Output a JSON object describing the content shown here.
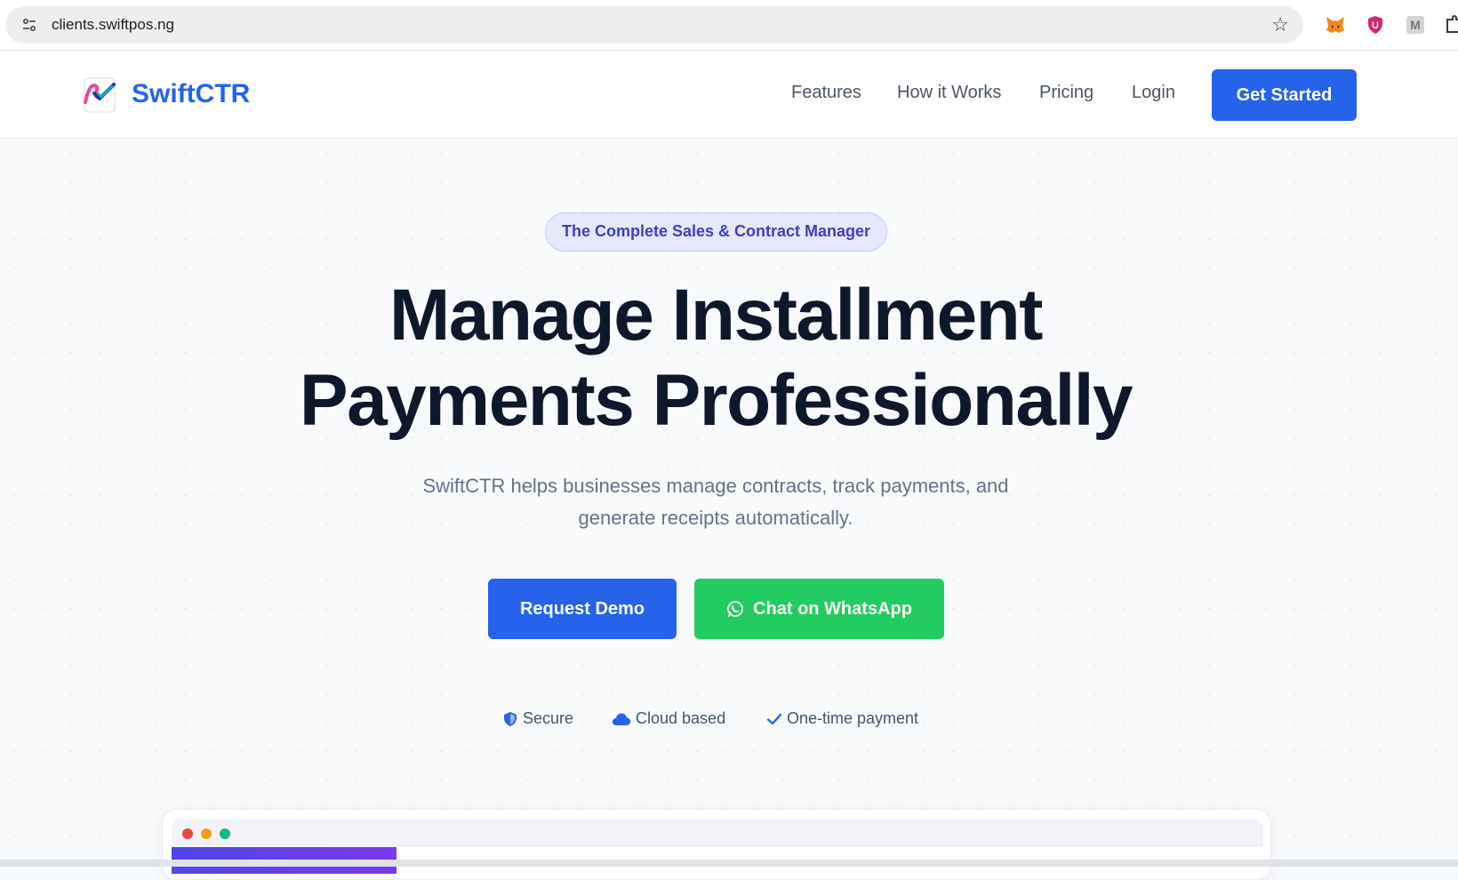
{
  "browser": {
    "url": "clients.swiftpos.ng",
    "icons": [
      "site-settings-icon",
      "bookmark-star-icon",
      "metamask-extension-icon",
      "ublock-extension-icon",
      "m-extension-icon",
      "extensions-puzzle-icon"
    ]
  },
  "header": {
    "brand_name": "SwiftCTR",
    "nav": [
      "Features",
      "How it Works",
      "Pricing",
      "Login"
    ],
    "cta_label": "Get Started"
  },
  "hero": {
    "pill_label": "The Complete Sales & Contract Manager",
    "headline_line1": "Manage Installment",
    "headline_line2": "Payments Professionally",
    "subtext_line1": "SwiftCTR helps businesses manage contracts, track payments, and",
    "subtext_line2": "generate receipts automatically.",
    "demo_label": "Request Demo",
    "whatsapp_label": "Chat on WhatsApp",
    "features": [
      {
        "label": "Secure",
        "icon": "shield-icon"
      },
      {
        "label": "Cloud based",
        "icon": "cloud-icon"
      },
      {
        "label": "One-time payment",
        "icon": "check-icon"
      }
    ]
  },
  "colors": {
    "primary": "#2563eb",
    "whatsapp": "#22cc5e",
    "headline": "#0f172a",
    "pill_bg": "#e6e8fd",
    "pill_text": "#3f3fc4"
  }
}
